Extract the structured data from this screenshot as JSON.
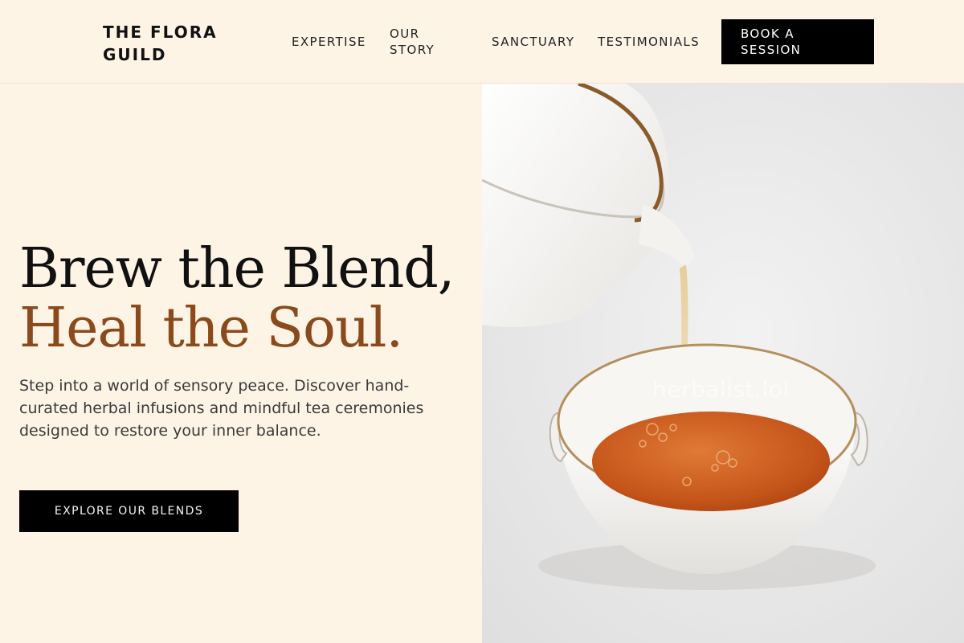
{
  "brand": {
    "name": "THE FLORA GUILD"
  },
  "nav": {
    "items": [
      {
        "label": "EXPERTISE"
      },
      {
        "label": "OUR STORY"
      },
      {
        "label": "SANCTUARY"
      },
      {
        "label": "TESTIMONIALS"
      }
    ],
    "cta_label": "BOOK A SESSION"
  },
  "hero": {
    "title_line1": "Brew the Blend,",
    "title_line2": "Heal the Soul.",
    "description": "Step into a world of sensory peace. Discover hand-curated herbal infusions and mindful tea ceremonies designed to restore your inner balance.",
    "button_label": "EXPLORE OUR BLENDS",
    "image_watermark": "herbalist.lol"
  },
  "colors": {
    "background": "#fdf4e6",
    "accent": "#8a4a1c",
    "button": "#000000",
    "tea": "#c8561a"
  }
}
